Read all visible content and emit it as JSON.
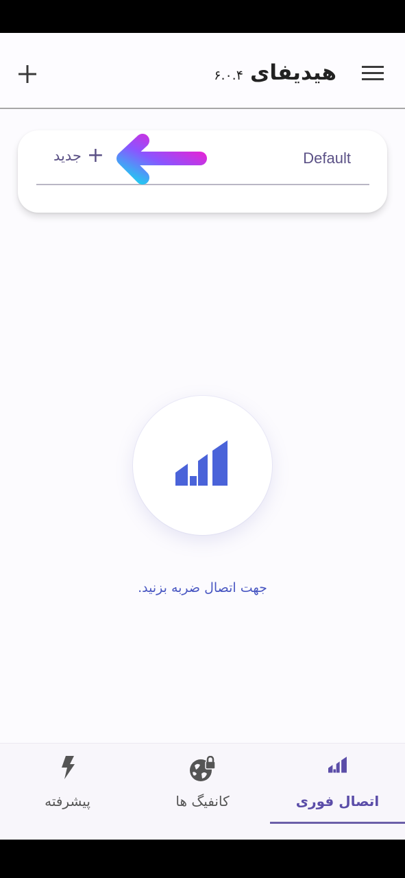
{
  "app_bar": {
    "title": "هیدیفای",
    "version": "۶.۰.۴",
    "menu_icon": "hamburger-menu-icon",
    "add_icon": "plus-icon"
  },
  "profile_card": {
    "default_label": "Default",
    "new_plus": "+",
    "new_label": "جدید",
    "arrow_icon": "gradient-arrow-left-icon"
  },
  "connect": {
    "logo_icon": "hiddify-logo-icon",
    "hint": "جهت اتصال ضربه بزنید."
  },
  "bottom_nav": {
    "items": [
      {
        "label": "پیشرفته",
        "icon": "lightning-icon"
      },
      {
        "label": "کانفیگ ها",
        "icon": "globe-lock-icon"
      },
      {
        "label": "اتصال فوری",
        "icon": "hiddify-logo-icon"
      }
    ],
    "active_index": 2
  },
  "colors": {
    "accent": "#4957c2",
    "nav_active": "#5b4da8",
    "indicator": "#6b5fa8",
    "logo_blue": "#4a63d9"
  }
}
